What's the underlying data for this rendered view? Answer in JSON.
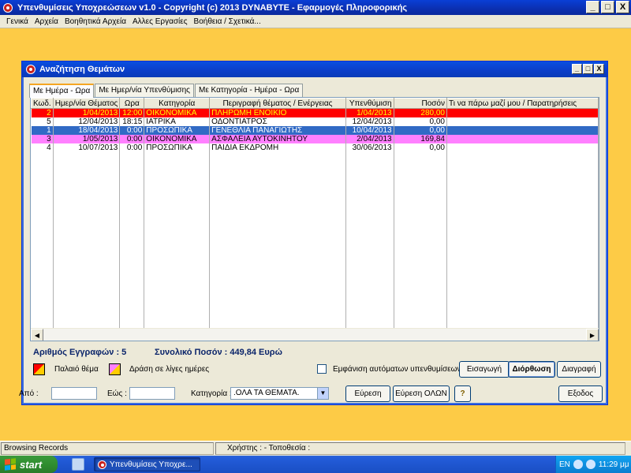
{
  "app": {
    "title": "Υπενθυμίσεις Υποχρεώσεων  v1.0   -   Copyright (c) 2013  DYNABYTE  - Εφαρμογές Πληροφορικής",
    "window_buttons": [
      "_",
      "□",
      "X"
    ]
  },
  "menu": [
    "Γενικά",
    "Αρχεία",
    "Βοηθητικά Αρχεία",
    "Αλλες Εργασίες",
    "Βοήθεια / Σχετικά..."
  ],
  "child_window": {
    "title": "Αναζήτηση Θεμάτων",
    "window_buttons": [
      "_",
      "□",
      "X"
    ]
  },
  "tabs": [
    "Με Ημέρα - Ωρα",
    "Με Ημερ/νία Υπενθύμισης",
    "Με Κατηγορία - Ημέρα - Ωρα"
  ],
  "grid": {
    "columns": [
      "Κωδ.",
      "Ημερ/νία Θέματος",
      "Ωρα",
      "Κατηγορία",
      "Περιγραφή θέματος / Ενέργειας",
      "Υπενθύμιση",
      "Ποσόν",
      "Τι να πάρω μαζί μου / Παρατηρήσεις"
    ],
    "rows": [
      {
        "code": "2",
        "date": "1/04/2013",
        "time": "12:00",
        "category": "ΟΙΚΟΝΟΜΙΚΑ",
        "description": "ΠΛΗΡΩΜΗ ΕΝΟΙΚΙΟ",
        "reminder": "1/04/2013",
        "amount": "280,00",
        "notes": "",
        "bg": "#ff0000",
        "fg": "#ffff00"
      },
      {
        "code": "5",
        "date": "12/04/2013",
        "time": "18:15",
        "category": "ΙΑΤΡΙΚΑ",
        "description": "ΟΔΟΝΤΙΑΤΡΟΣ",
        "reminder": "12/04/2013",
        "amount": "0,00",
        "notes": "",
        "bg": "#ffffff",
        "fg": "#000000"
      },
      {
        "code": "1",
        "date": "18/04/2013",
        "time": "0:00",
        "category": "ΠΡΟΣΩΠΙΚΑ",
        "description": "ΓΕΝΕΘΛΙΑ ΠΑΝΑΓΙΩΤΗΣ",
        "reminder": "10/04/2013",
        "amount": "0,00",
        "notes": "",
        "bg": "#316ac5",
        "fg": "#ffffff"
      },
      {
        "code": "3",
        "date": "1/05/2013",
        "time": "0:00",
        "category": "ΟΙΚΟΝΟΜΙΚΑ",
        "description": "ΑΣΦΑΛΕΙΑ ΑΥΤΟΚΙΝΗΤΟΥ",
        "reminder": "2/04/2013",
        "amount": "169,84",
        "notes": "",
        "bg": "#ff80ff",
        "fg": "#000000"
      },
      {
        "code": "4",
        "date": "10/07/2013",
        "time": "0:00",
        "category": "ΠΡΟΣΩΠΙΚΑ",
        "description": "ΠΑΙΔΙΑ ΕΚΔΡΟΜΗ",
        "reminder": "30/06/2013",
        "amount": "0,00",
        "notes": "",
        "bg": "#ffffff",
        "fg": "#000000"
      }
    ]
  },
  "summary": {
    "records_label": "Αριθμός Εγγραφών : 5",
    "total_label": "Συνολικό Ποσόν : 449,84 Ευρώ"
  },
  "legend": {
    "old_label": "Παλαιό θέμα",
    "soon_label": "Δράση σε λίγες ημέρες"
  },
  "auto_reminders_label": "Εμφάνιση αυτόματων υπενθυμίσεων",
  "buttons": {
    "insert": "Εισαγωγή",
    "edit": "Διόρθωση",
    "delete": "Διαγραφή",
    "search": "Εύρεση",
    "search_all": "Εύρεση ΟΛΩΝ",
    "exit": "Εξοδος"
  },
  "filters": {
    "from_label": "Από :",
    "to_label": "Εώς :",
    "from_value": "",
    "to_value": "",
    "category_label": "Κατηγορία :",
    "category_value": ".ΟΛΑ ΤΑ ΘΕΜΑΤΑ."
  },
  "statusbar": {
    "status": "Browsing Records",
    "user": "Χρήστης :   - Τοποθεσία :"
  },
  "taskbar": {
    "start": "start",
    "task": "Υπενθυμίσεις Υποχρε...",
    "lang": "EN",
    "clock": "11:29 μμ"
  },
  "colors": {
    "legend_old": "#ff0000",
    "legend_soon": "#ff80ff",
    "desktop": "#fdcb46"
  }
}
